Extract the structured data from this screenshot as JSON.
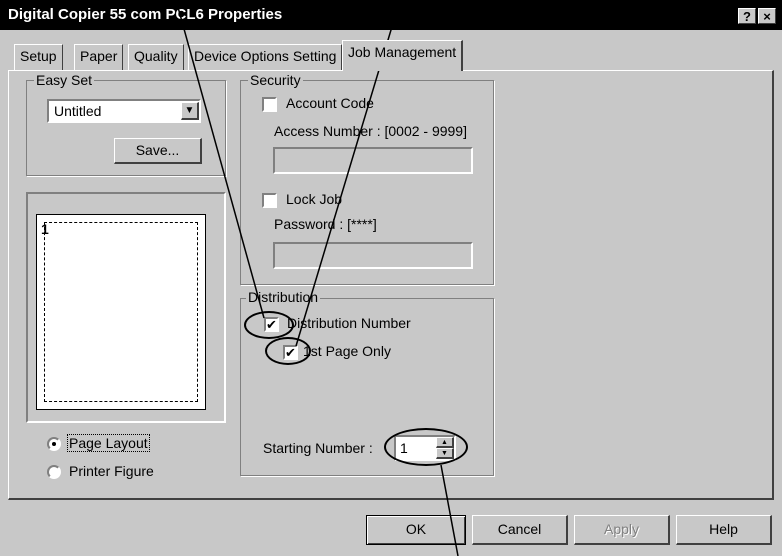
{
  "window": {
    "title": "Digital Copier 55 com PCL6 Properties",
    "help_btn": "?",
    "close_btn": "×"
  },
  "tabs": [
    {
      "label": "Setup"
    },
    {
      "label": "Paper"
    },
    {
      "label": "Quality"
    },
    {
      "label": "Device Options Setting"
    },
    {
      "label": "Job Management"
    }
  ],
  "easy_set": {
    "legend": "Easy Set",
    "selected": "Untitled",
    "save_label": "Save..."
  },
  "preview": {
    "page_number": "1"
  },
  "view_options": {
    "page_layout": "Page Layout",
    "printer_figure": "Printer Figure",
    "selected": "Page Layout"
  },
  "security": {
    "legend": "Security",
    "account_code": {
      "label": "Account Code",
      "checked": false
    },
    "access_number_label": "Access Number : [0002 - 9999]",
    "access_number_value": "",
    "lock_job": {
      "label": "Lock Job",
      "checked": false
    },
    "password_label": "Password : [****]",
    "password_value": ""
  },
  "distribution": {
    "legend": "Distribution",
    "distribution_number": {
      "label": "Distribution Number",
      "checked": true
    },
    "first_page_only": {
      "label": "1st Page Only",
      "checked": true
    },
    "starting_number_label": "Starting Number :",
    "starting_number_value": "1"
  },
  "buttons": {
    "ok": "OK",
    "cancel": "Cancel",
    "apply": "Apply",
    "help": "Help"
  },
  "check_glyph": "✔"
}
